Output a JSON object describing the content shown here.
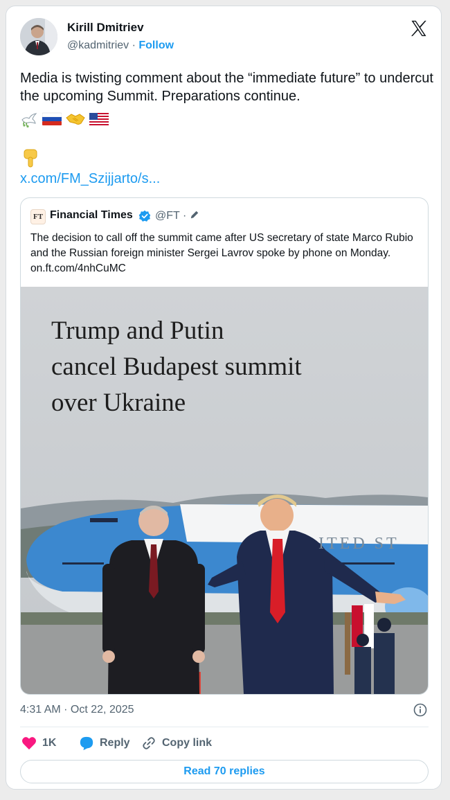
{
  "author": {
    "name": "Kirill Dmitriev",
    "handle": "@kadmitriev",
    "separator": " · ",
    "follow_label": "Follow"
  },
  "tweet": {
    "text": "Media is twisting comment about the “immediate future” to undercut the upcoming Summit. Preparations continue.",
    "emojis": [
      "dove",
      "russia-flag",
      "handshake",
      "us-flag"
    ],
    "pointing_emoji": "backhand-index-pointing-down",
    "link": "x.com/FM_Szijjarto/s..."
  },
  "quote": {
    "name": "Financial Times",
    "logo_text": "FT",
    "handle": "@FT · ",
    "verified": true,
    "text": "The decision to call off the summit came after US secretary of state Marco Rubio and the Russian foreign minister Sergei Lavrov spoke by phone on Monday. on.ft.com/4nhCuMC",
    "image": {
      "headline_lines": [
        "Trump and Putin",
        "cancel Budapest summit",
        "over Ukraine"
      ],
      "plane_text": "ITED ST",
      "description_colors": {
        "sky": "#d2d5d8",
        "plane_blue": "#3b8ad0",
        "tie_red": "#c1272d"
      }
    }
  },
  "meta": {
    "timestamp": "4:31 AM · Oct 22, 2025"
  },
  "actions": {
    "likes": "1K",
    "reply_label": "Reply",
    "copy_label": "Copy link",
    "read_replies": "Read 70 replies"
  },
  "colors": {
    "accent": "#1d9bf0",
    "like": "#f91880",
    "text": "#0f1419",
    "muted": "#536471"
  }
}
